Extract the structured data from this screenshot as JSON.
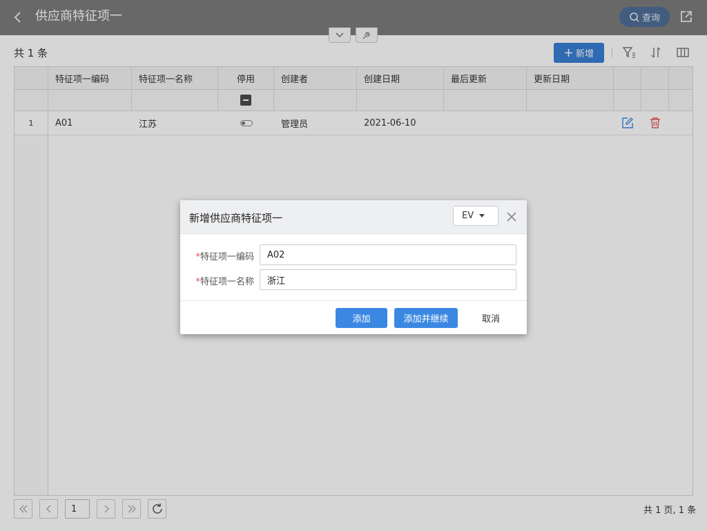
{
  "header": {
    "title": "供应商特征项一",
    "query_label": "查询"
  },
  "toolbar": {
    "count_text": "共 1 条",
    "add_label": "新增"
  },
  "table": {
    "columns": [
      "特征项一编码",
      "特征项一名称",
      "停用",
      "创建者",
      "创建日期",
      "最后更新",
      "更新日期"
    ],
    "rows": [
      {
        "index": "1",
        "code": "A01",
        "name": "江苏",
        "disabled": false,
        "creator": "管理员",
        "created": "2021-06-10",
        "last_updated_by": "",
        "updated": ""
      }
    ]
  },
  "pagination": {
    "page": "1",
    "summary": "共 1 页, 1 条"
  },
  "dialog": {
    "title": "新增供应商特征项一",
    "language": "EV",
    "fields": [
      {
        "required_mark": "*",
        "label": "特征项一编码",
        "value": "A02"
      },
      {
        "required_mark": "*",
        "label": "特征项一名称",
        "value": "浙江"
      }
    ],
    "buttons": {
      "add": "添加",
      "add_continue": "添加并继续",
      "cancel": "取消"
    }
  },
  "colors": {
    "primary": "#3b88e3",
    "header_bg": "#7d7d7d",
    "delete_icon": "#e05c5c"
  },
  "icons": [
    "back-arrow-icon",
    "search-icon",
    "share-icon",
    "chevron-down-icon",
    "pin-icon",
    "plus-icon",
    "filter-icon",
    "sort-icon",
    "columns-icon",
    "edit-icon",
    "trash-icon",
    "close-icon",
    "first-page-icon",
    "prev-page-icon",
    "next-page-icon",
    "last-page-icon",
    "refresh-icon"
  ]
}
